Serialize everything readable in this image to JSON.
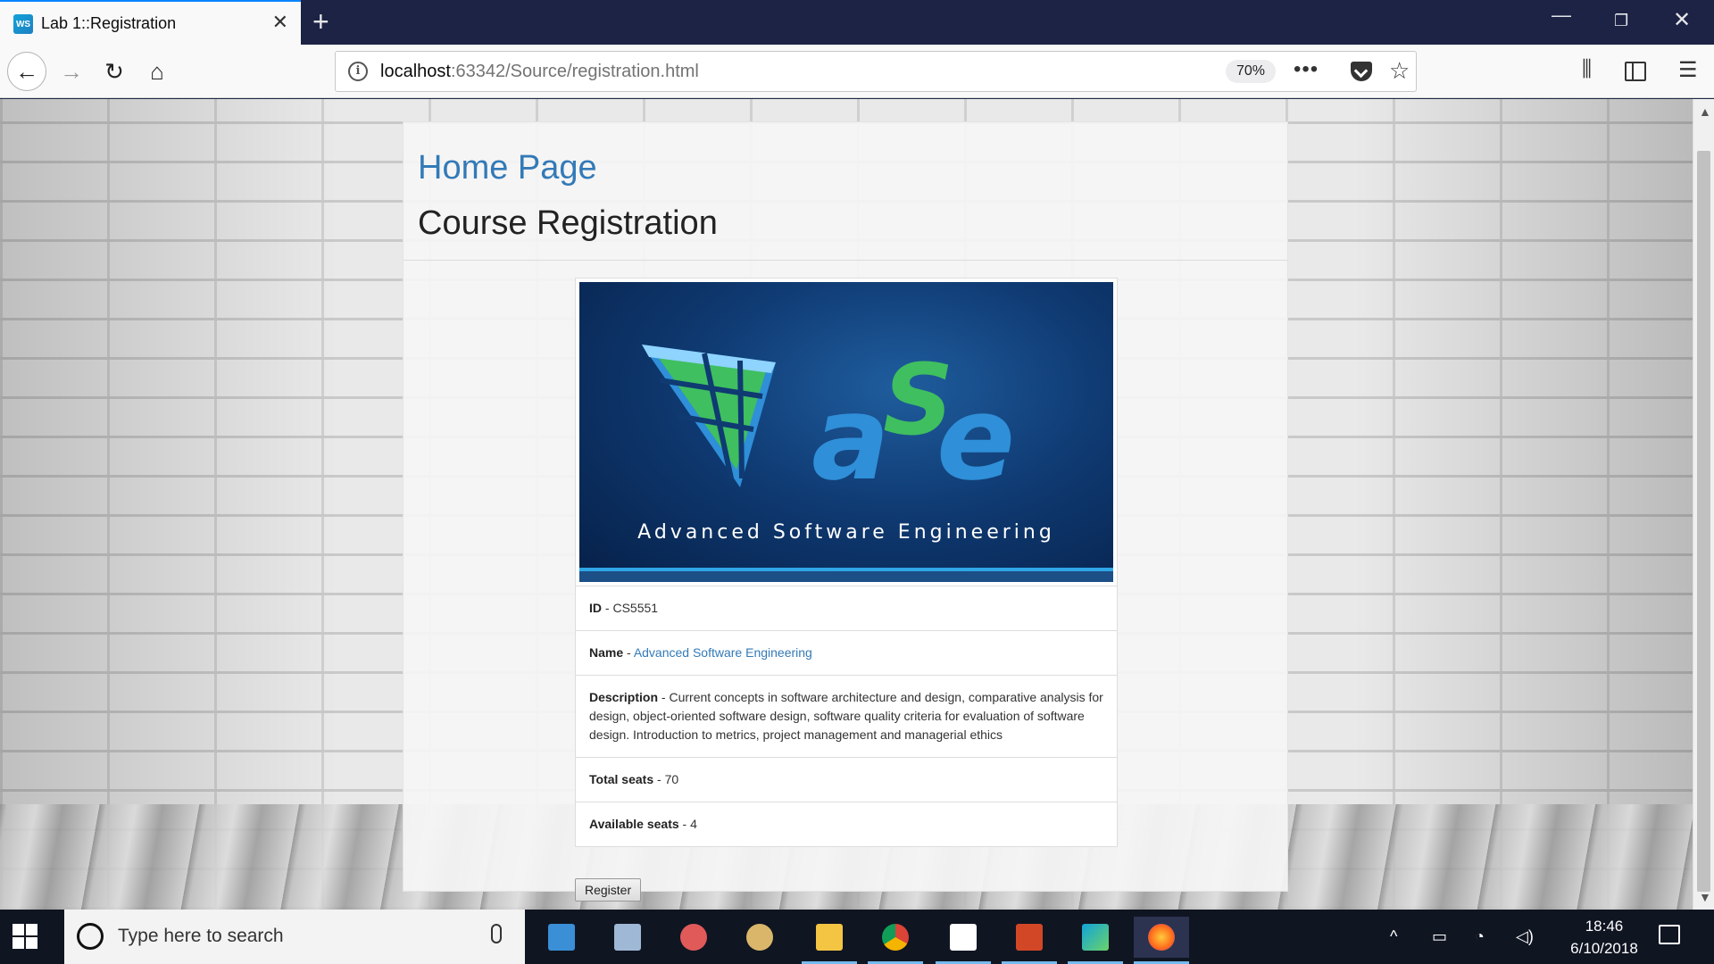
{
  "browser": {
    "tab_title": "Lab 1::Registration",
    "favicon_text": "WS",
    "url_host": "localhost",
    "url_rest": ":63342/Source/registration.html",
    "zoom": "70%",
    "more_label": "•••"
  },
  "page": {
    "home_link": "Home Page",
    "title": "Course Registration",
    "banner_caption": "Advanced Software Engineering",
    "fields": [
      {
        "label": "ID",
        "value": "CS5551"
      },
      {
        "label": "Name",
        "value": "Advanced Software Engineering"
      },
      {
        "label": "Description",
        "value": "Current concepts in software architecture and design, comparative analysis for design, object-oriented software design, software quality criteria for evaluation of software design. Introduction to metrics, project management and managerial ethics"
      },
      {
        "label": "Total seats",
        "value": "70"
      },
      {
        "label": "Available seats",
        "value": "4"
      }
    ],
    "separator": " - ",
    "register_label": "Register"
  },
  "taskbar": {
    "search_placeholder": "Type here to search",
    "time": "18:46",
    "date": "6/10/2018",
    "apps": [
      "control-panel-icon",
      "photos-icon",
      "snipping-tool-icon",
      "paint-icon",
      "file-explorer-icon",
      "chrome-icon",
      "sticky-notes-icon",
      "powerpoint-icon",
      "webstorm-icon",
      "firefox-icon"
    ]
  },
  "colors": {
    "link": "#337ab7",
    "tab_accent": "#0a84ff",
    "banner_green": "#3fbf5f",
    "banner_blue": "#2f8fd8"
  }
}
